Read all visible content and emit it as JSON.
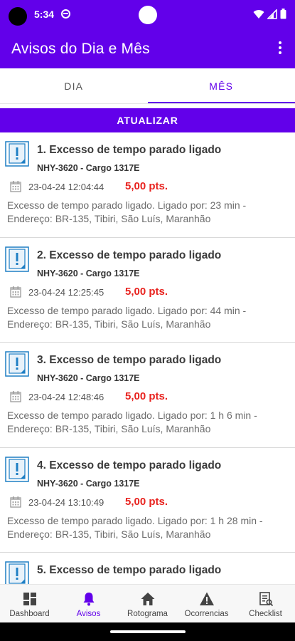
{
  "status": {
    "time": "5:34"
  },
  "app": {
    "title": "Avisos do Dia e Mês"
  },
  "tabs": [
    {
      "label": "DIA",
      "active": false
    },
    {
      "label": "MÊS",
      "active": true
    }
  ],
  "update_button": {
    "label": "ATUALIZAR"
  },
  "notices": [
    {
      "title": "1. Excesso de tempo parado ligado",
      "vehicle": "NHY-3620 - Cargo 1317E",
      "date": "23-04-24 12:04:44",
      "points": "5,00 pts.",
      "description": "Excesso de tempo parado ligado. Ligado por: 23 min  - Endereço: BR-135, Tibiri, São Luís, Maranhão"
    },
    {
      "title": "2. Excesso de tempo parado ligado",
      "vehicle": "NHY-3620 - Cargo 1317E",
      "date": "23-04-24 12:25:45",
      "points": "5,00 pts.",
      "description": "Excesso de tempo parado ligado. Ligado por: 44 min  - Endereço: BR-135, Tibiri, São Luís, Maranhão"
    },
    {
      "title": "3. Excesso de tempo parado ligado",
      "vehicle": "NHY-3620 - Cargo 1317E",
      "date": "23-04-24 12:48:46",
      "points": "5,00 pts.",
      "description": "Excesso de tempo parado ligado. Ligado por: 1 h 6 min  - Endereço: BR-135, Tibiri, São Luís, Maranhão"
    },
    {
      "title": "4. Excesso de tempo parado ligado",
      "vehicle": "NHY-3620 - Cargo 1317E",
      "date": "23-04-24 13:10:49",
      "points": "5,00 pts.",
      "description": "Excesso de tempo parado ligado. Ligado por: 1 h 28 min  - Endereço: BR-135, Tibiri, São Luís, Maranhão"
    },
    {
      "title": "5. Excesso de tempo parado ligado",
      "vehicle": "",
      "date": "",
      "points": "",
      "description": ""
    }
  ],
  "bottom_nav": [
    {
      "label": "Dashboard",
      "icon": "dashboard-icon",
      "active": false
    },
    {
      "label": "Avisos",
      "icon": "bell-icon",
      "active": true
    },
    {
      "label": "Rotograma",
      "icon": "home-icon",
      "active": false
    },
    {
      "label": "Ocorrencias",
      "icon": "warning-icon",
      "active": false
    },
    {
      "label": "Checklist",
      "icon": "checklist-icon",
      "active": false
    }
  ],
  "colors": {
    "primary": "#6200ea",
    "points": "#e8231f",
    "accent_icon": "#1e7fc4"
  }
}
